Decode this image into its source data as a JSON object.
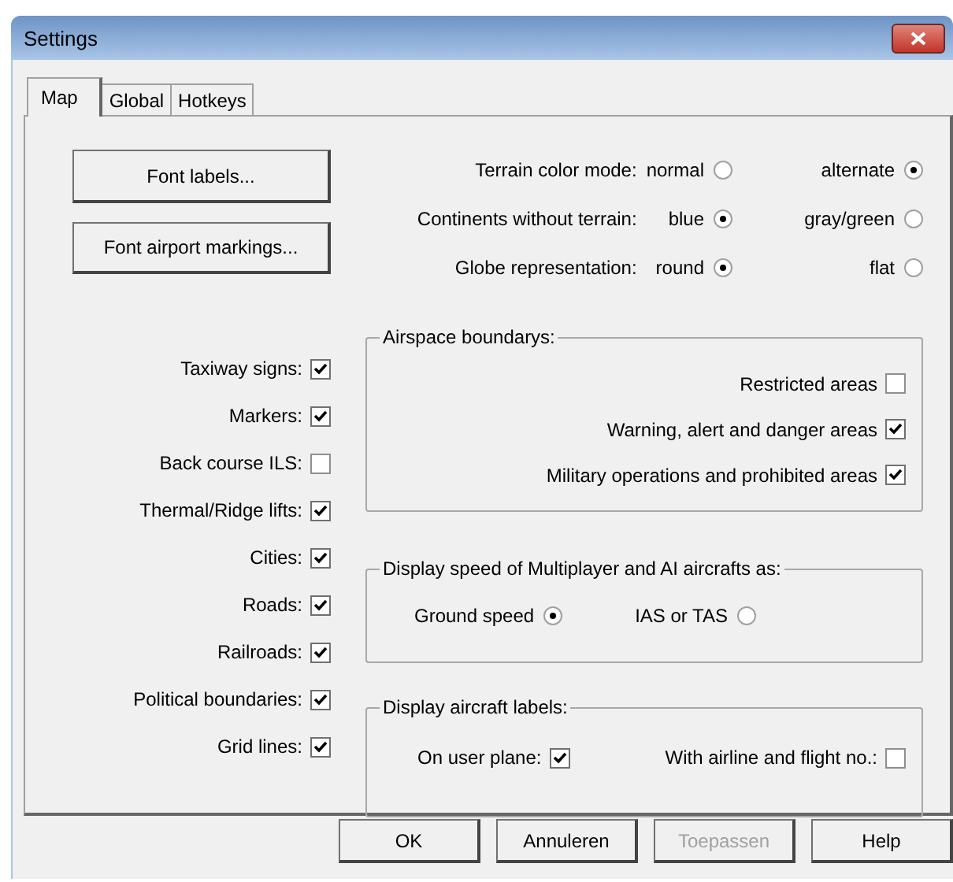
{
  "window": {
    "title": "Settings"
  },
  "tabs": [
    {
      "label": "Map",
      "selected": true
    },
    {
      "label": "Global",
      "selected": false
    },
    {
      "label": "Hotkeys",
      "selected": false
    }
  ],
  "font_buttons": [
    "Font labels...",
    "Font airport markings..."
  ],
  "map_options": [
    {
      "label": "Taxiway signs:",
      "checked": true
    },
    {
      "label": "Markers:",
      "checked": true
    },
    {
      "label": "Back course ILS:",
      "checked": false
    },
    {
      "label": "Thermal/Ridge lifts:",
      "checked": true
    },
    {
      "label": "Cities:",
      "checked": true
    },
    {
      "label": "Roads:",
      "checked": true
    },
    {
      "label": "Railroads:",
      "checked": true
    },
    {
      "label": "Political boundaries:",
      "checked": true
    },
    {
      "label": "Grid lines:",
      "checked": true
    }
  ],
  "display_modes": [
    {
      "label": "Terrain color mode:",
      "options": [
        {
          "label": "normal",
          "selected": false
        },
        {
          "label": "alternate",
          "selected": true
        }
      ]
    },
    {
      "label": "Continents without terrain:",
      "options": [
        {
          "label": "blue",
          "selected": true
        },
        {
          "label": "gray/green",
          "selected": false
        }
      ]
    },
    {
      "label": "Globe representation:",
      "options": [
        {
          "label": "round",
          "selected": true
        },
        {
          "label": "flat",
          "selected": false
        }
      ]
    }
  ],
  "airspace": {
    "title": "Airspace boundarys:",
    "items": [
      {
        "label": "Restricted areas",
        "checked": false
      },
      {
        "label": "Warning, alert and danger areas",
        "checked": true
      },
      {
        "label": "Military operations and prohibited areas",
        "checked": true
      }
    ]
  },
  "speed": {
    "title": "Display speed of Multiplayer and AI aircrafts as:",
    "options": [
      {
        "label": "Ground speed",
        "selected": true
      },
      {
        "label": "IAS or TAS",
        "selected": false
      }
    ]
  },
  "aircraft_labels": {
    "title": "Display aircraft labels:",
    "items": [
      {
        "label": "On user plane:",
        "checked": true
      },
      {
        "label": "With airline and flight no.:",
        "checked": false
      }
    ]
  },
  "footer_buttons": [
    {
      "label": "OK",
      "disabled": false
    },
    {
      "label": "Annuleren",
      "disabled": false
    },
    {
      "label": "Toepassen",
      "disabled": true
    },
    {
      "label": "Help",
      "disabled": false
    }
  ]
}
